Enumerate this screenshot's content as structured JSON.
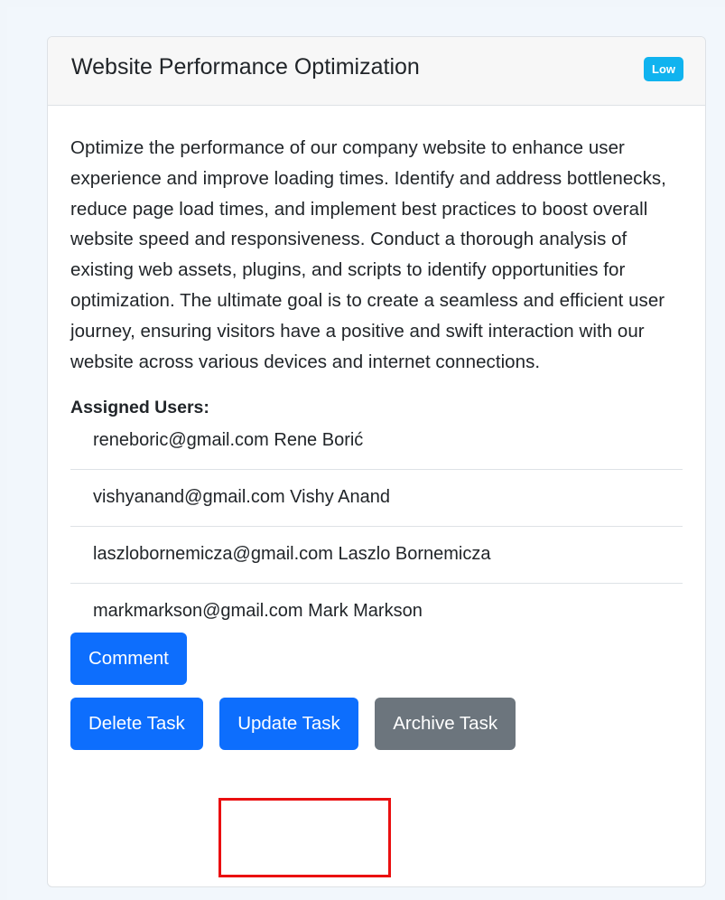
{
  "task": {
    "title": "Website Performance Optimization",
    "priority": "Low",
    "description": "Optimize the performance of our company website to enhance user experience and improve loading times. Identify and address bottlenecks, reduce page load times, and implement best practices to boost overall website speed and responsiveness. Conduct a thorough analysis of existing web assets, plugins, and scripts to identify opportunities for optimization. The ultimate goal is to create a seamless and efficient user journey, ensuring visitors have a positive and swift interaction with our website across various devices and internet connections.",
    "assigned_label": "Assigned Users:",
    "assigned_users": [
      "reneboric@gmail.com Rene Borić",
      "vishyanand@gmail.com Vishy Anand",
      "laszlobornemicza@gmail.com Laszlo Bornemicza",
      "markmarkson@gmail.com Mark Markson"
    ]
  },
  "buttons": {
    "comment": "Comment",
    "delete": "Delete Task",
    "update": "Update Task",
    "archive": "Archive Task"
  },
  "colors": {
    "primary": "#0d6efd",
    "secondary": "#6c757d",
    "badge": "#10b3ef",
    "highlight": "#ea0f10"
  }
}
